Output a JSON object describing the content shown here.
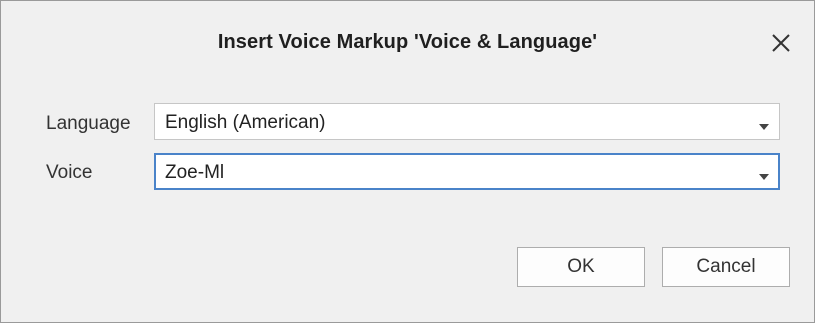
{
  "dialog": {
    "title": "Insert Voice Markup 'Voice & Language'",
    "close_icon": "close-icon"
  },
  "fields": {
    "language": {
      "label": "Language",
      "value": "English (American)"
    },
    "voice": {
      "label": "Voice",
      "value": "Zoe-Ml"
    }
  },
  "buttons": {
    "ok_label": "OK",
    "cancel_label": "Cancel"
  },
  "icons": {
    "dropdown": "chevron-down-icon"
  },
  "colors": {
    "dialog_background": "#f0f0f0",
    "focus_border": "#4a83c9",
    "field_background": "#ffffff"
  }
}
